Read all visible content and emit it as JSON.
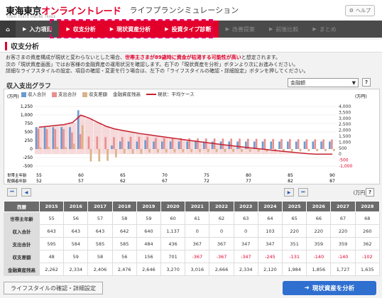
{
  "header": {
    "brand_black": "東海東京",
    "brand_red": "オンライントレード",
    "brand_sub": "TOKAI TOKYO ONLINE TRADE",
    "app_title": "ライフプランシミュレーション",
    "help_label": "ヘルプ"
  },
  "nav": {
    "items": [
      "入力項目",
      "収支分析",
      "現状資産分析",
      "投資タイプ診断",
      "改善提案",
      "前後比較",
      "まとめ"
    ]
  },
  "section": {
    "title": "収支分析"
  },
  "desc": {
    "line1a": "お客さまの資産構成が現状と変わらないとした場合、",
    "line1warn": "世帯主さまが89歳時に資金が枯渇する可能性が高い",
    "line1b": "と想定されます。",
    "line2": "次の「現状資産画面」ではお客様の金融資産の運用状況を確認します。右下の「現状資産を分析」ボタンより次にお進みください。",
    "line3": "詳細なライフスタイルの設定、項目の確認・変更を行う場合は、左下の「ライフスタイルの確認・詳細設定」ボタンを押してください。"
  },
  "chart_title": "収入支出グラフ",
  "dropdown_value": "金融額",
  "chart_data": {
    "type": "bar",
    "left_unit": "(万円)",
    "right_unit": "(万円)",
    "legend": [
      "収入合計",
      "支出合計",
      "収支差額",
      "金融資産残高",
      "現状：平均ケース"
    ],
    "left_ticks": [
      "1,250",
      "1,000",
      "750",
      "500",
      "250",
      "0",
      "-250",
      "-500"
    ],
    "right_ticks": [
      "4,000",
      "3,500",
      "3,000",
      "2,500",
      "2,000",
      "1,500",
      "1,000",
      "500",
      "0",
      "-500",
      "-1,000"
    ],
    "age_head_label": "世帯主年齢",
    "age_spouse_label": "配偶者年齢",
    "age_head": [
      "55",
      "60",
      "65",
      "70",
      "75",
      "80",
      "85",
      "90"
    ],
    "age_spouse": [
      "52",
      "57",
      "62",
      "67",
      "72",
      "77",
      "82",
      "87"
    ],
    "income": [
      643,
      643,
      643,
      643,
      640,
      1137,
      0,
      0,
      0,
      103,
      220,
      220,
      220,
      260
    ],
    "expense": [
      595,
      584,
      585,
      585,
      484,
      436,
      367,
      367,
      347,
      347,
      351,
      359,
      359,
      362
    ],
    "diff": [
      48,
      59,
      58,
      56,
      156,
      701,
      -367,
      -367,
      -347,
      -245,
      -131,
      -140,
      -140,
      -102
    ],
    "assets": [
      2262,
      2334,
      2406,
      2476,
      2646,
      3270,
      3016,
      2666,
      2334,
      2120,
      1984,
      1856,
      1727,
      1635
    ],
    "ylim_left": [
      -500,
      1250
    ],
    "ylim_right": [
      -1000,
      4000
    ]
  },
  "scroll": {
    "unit": "(万円)"
  },
  "table": {
    "corner": "西暦",
    "years": [
      "2015",
      "2016",
      "2017",
      "2018",
      "2019",
      "2020",
      "2021",
      "2022",
      "2023",
      "2024",
      "2025",
      "2026",
      "2027",
      "2028"
    ],
    "rows": [
      {
        "label": "世帯主年齢",
        "values": [
          "55",
          "56",
          "57",
          "58",
          "59",
          "60",
          "61",
          "62",
          "63",
          "64",
          "65",
          "66",
          "67",
          "68"
        ]
      },
      {
        "label": "収入合計",
        "values": [
          "643",
          "643",
          "643",
          "642",
          "640",
          "1,137",
          "0",
          "0",
          "0",
          "103",
          "220",
          "220",
          "220",
          "260"
        ]
      },
      {
        "label": "支出合計",
        "values": [
          "595",
          "584",
          "585",
          "585",
          "484",
          "436",
          "367",
          "367",
          "347",
          "347",
          "351",
          "359",
          "359",
          "362"
        ]
      },
      {
        "label": "収支差額",
        "values": [
          "48",
          "59",
          "58",
          "56",
          "156",
          "701",
          "-367",
          "-367",
          "-347",
          "-245",
          "-131",
          "-140",
          "-140",
          "-102"
        ]
      },
      {
        "label": "金融資産残高",
        "values": [
          "2,262",
          "2,334",
          "2,406",
          "2,476",
          "2,646",
          "3,270",
          "3,016",
          "2,666",
          "2,334",
          "2,120",
          "1,984",
          "1,856",
          "1,727",
          "1,635"
        ]
      }
    ]
  },
  "buttons": {
    "lifestyle": "ライフスタイルの確認・詳細設定",
    "analyze": "現状資産を分析"
  },
  "colors": {
    "brand": "#e2002b",
    "income": "#6b9bd1",
    "expense": "#e8908f",
    "diff": "#d9b48a",
    "assets": "#f2c9cb",
    "avg_line": "#c4202f"
  }
}
